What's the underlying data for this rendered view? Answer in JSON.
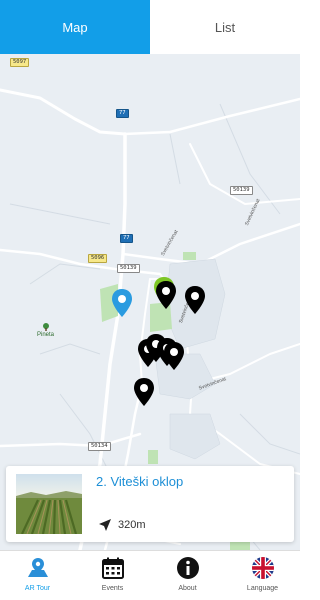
{
  "tabs": {
    "map": "Map",
    "list": "List"
  },
  "map": {
    "road_shields": {
      "s5097": "5097",
      "r77a": "77",
      "r77b": "77",
      "s5096": "5096",
      "s50139a": "50139",
      "s50139b": "50139",
      "s50134": "50134"
    },
    "road_names": {
      "svetvincenat_1": "Svetvinčenat",
      "svetvincenat_2": "Svetvinčenat",
      "svetvincenat_3": "Svetvinčenat",
      "svetvincenat_4": "Svetvinčenat"
    },
    "poi": {
      "pineta": "Pineta"
    }
  },
  "card": {
    "title": "2. Viteški oklop",
    "distance": "320m",
    "nav_icon": "navigation-arrow-icon"
  },
  "bottom_nav": {
    "ar_tour": "AR Tour",
    "events": "Events",
    "about": "About",
    "language": "Language"
  },
  "colors": {
    "accent": "#129ee8",
    "pin_black": "#000000",
    "pin_green": "#7dc626",
    "pin_blue": "#2a9be0"
  }
}
